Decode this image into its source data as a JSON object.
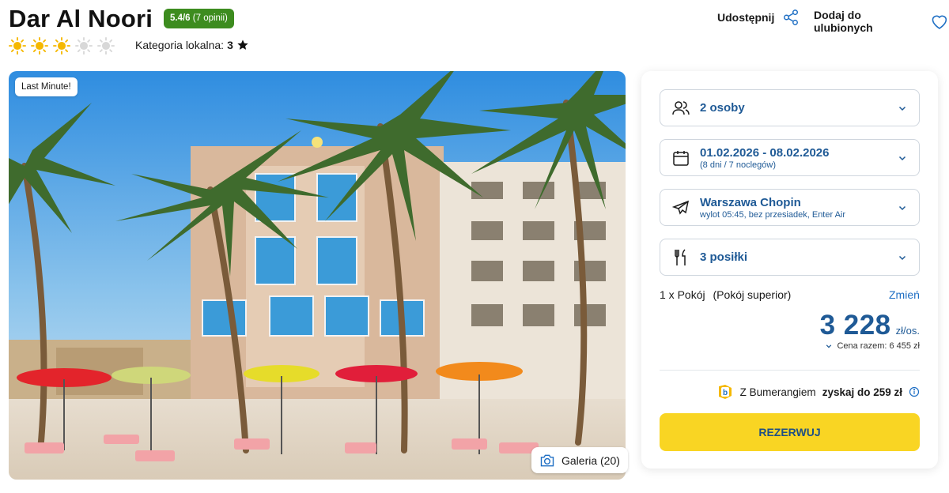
{
  "hotel": {
    "name": "Dar Al Noori",
    "rating_score": "5.4/6",
    "rating_reviews": "(7 opinii)",
    "suns_filled": 3,
    "suns_total": 5,
    "local_category_label": "Kategoria lokalna:",
    "local_category_value": "3"
  },
  "header_actions": {
    "share_label": "Udostępnij",
    "favorite_label": "Dodaj do ulubionych"
  },
  "photo": {
    "badge": "Last Minute!",
    "gallery_label": "Galeria (20)"
  },
  "booking": {
    "persons": "2 osoby",
    "dates": "01.02.2026 - 08.02.2026",
    "dates_sub": "(8 dni / 7 noclegów)",
    "airport": "Warszawa Chopin",
    "flight_sub": "wylot 05:45, bez przesiadek, Enter Air",
    "meals": "3 posiłki",
    "room_count": "1 x Pokój",
    "room_type": "(Pokój superior)",
    "change_label": "Zmień",
    "price": "3 228",
    "price_unit": "zł/os.",
    "total_label": "Cena razem: 6 455 zł",
    "bumerang_prefix": "Z Bumerangiem",
    "bumerang_highlight": "zyskaj do 259 zł",
    "reserve_label": "REZERWUJ"
  },
  "colors": {
    "accent_blue": "#1f5a96",
    "link_blue": "#1f6fc4",
    "rating_green": "#3d8c1f",
    "reserve_yellow": "#f9d523",
    "sun_yellow": "#f5b800"
  }
}
